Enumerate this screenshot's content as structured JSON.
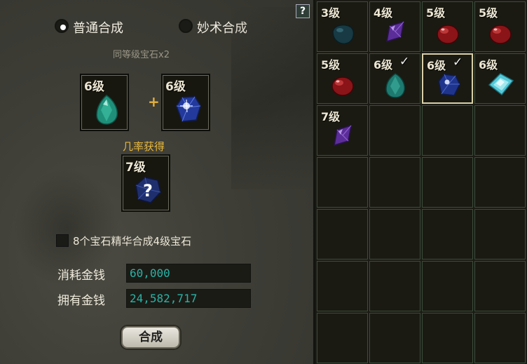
{
  "left_panel": {
    "help_label": "?",
    "mode_normal": "普通合成",
    "mode_special": "妙术合成",
    "requirement": "同等级宝石x2",
    "input_slot_1": {
      "level": "6级",
      "gem": "teal-gem"
    },
    "plus_sign": "+",
    "input_slot_2": {
      "level": "6级",
      "gem": "blue-gem"
    },
    "chance_label": "几率获得",
    "result_slot": {
      "level": "7级",
      "gem": "unknown-blue-gem",
      "mark": "?"
    },
    "essence_checkbox_label": "8个宝石精华合成4级宝石",
    "cost_label": "消耗金钱",
    "cost_value": "60,000",
    "owned_label": "拥有金钱",
    "owned_value": "24,582,717",
    "combine_button": "合成"
  },
  "inventory": {
    "items": [
      {
        "level": "3级",
        "gem": "dark-teal-gem",
        "checked": false
      },
      {
        "level": "4级",
        "gem": "purple-gem",
        "checked": false
      },
      {
        "level": "5级",
        "gem": "red-gem",
        "checked": false
      },
      {
        "level": "5级",
        "gem": "red-gem",
        "checked": false
      },
      {
        "level": "5级",
        "gem": "red-gem",
        "checked": false
      },
      {
        "level": "6级",
        "gem": "teal-gem",
        "checked": true,
        "check": "✓"
      },
      {
        "level": "6级",
        "gem": "blue-gem",
        "checked": true,
        "check": "✓",
        "selected": true
      },
      {
        "level": "6级",
        "gem": "cyan-gem",
        "checked": false
      },
      {
        "level": "7级",
        "gem": "purple-gem",
        "checked": false
      }
    ]
  },
  "colors": {
    "accent_gold": "#e8b73a",
    "money_teal": "#29b3a6"
  }
}
